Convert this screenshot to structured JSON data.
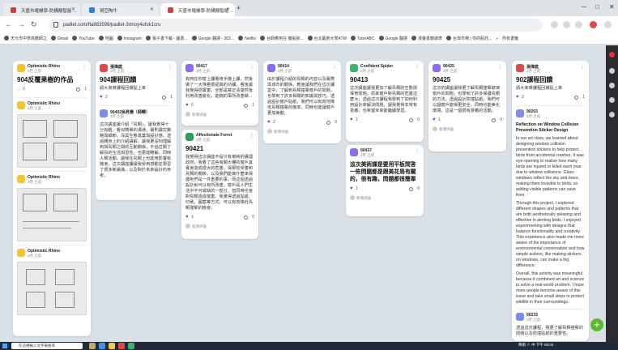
{
  "browser": {
    "tabs": [
      {
        "title": "天盛市電機學-防構擬智能 ...",
        "color": "#d83b3b"
      },
      {
        "title": "哥亞陶牛",
        "color": "#3b7bd8"
      },
      {
        "title": "天盛市電機學-防構擬智能 ...",
        "color": "#d83b3b"
      }
    ],
    "new_tab": "+",
    "window_controls": [
      "─",
      "□",
      "✕"
    ],
    "nav": {
      "back": "←",
      "forward": "→",
      "reload": "↻"
    },
    "url": "padlet.com/fla883599/padlet-3rtnoy4ufok1cru",
    "bookmarks": [
      "天元市中學高教師之",
      "Gmail",
      "YouTube",
      "地圖",
      "Instagram",
      "電子書下載 - 圖書...",
      "Google 翻譯 - 202...",
      "Netflix",
      "台師應用在 撤股資...",
      "台北藝術大學ATM",
      "TutorABC",
      "Google 翻譯",
      "漫畫書籍總表",
      "台灣市場 | 你的股託..."
    ],
    "bookmarks_more": "»",
    "all_bookmarks": "所有書籤"
  },
  "cards": {
    "c1": {
      "author": "Optimistic Rhino",
      "time": "3月 之前",
      "title": "904反覆果樹的作品",
      "likes": "0",
      "comments": "1",
      "sub": {
        "author": "Optimistic Rhino",
        "time": "3月 之前"
      },
      "sub2": {
        "author": "Optimistic Rhino",
        "time": "3月 之前"
      },
      "sub3": {
        "author": "Optimistic Rhino",
        "time": "3月 之前"
      }
    },
    "c2": {
      "author": "張偉庭",
      "time": "3月 之前",
      "title": "904課程回饋",
      "body": "請大家將課程回饋貼上來",
      "likes": "2",
      "comments": "1",
      "sub": {
        "author": "90402吳昇儒（師轉）",
        "time": "3月 之前",
        "body": "這次講座讓介紹「鳥類」。讓我覺得十分有趣，看似簡單的溝通，實則講究策略與細節，深具生態專業與設計感。透過親身上的介紹講解，讓我更深刻理解到與鳥類之間的互動關係，不過這類了解鳥的生活與習性。也更能瞭解，同時人類活動。讓我在鳥類上也能用影響有機會，這次講座課讓我受到感動並學習了很多新識識，以及對於未來設計的參考。"
      }
    },
    "c3": {
      "author": "90417",
      "time": "3月 之前",
      "body": "有時在你窗上課看用手機上課，然後做了一大堆看很認真的功課，看後讓我覺得很厲害，全部是寫正清楚然後利用改善變化，能夠的事所改善做...",
      "likes": "0",
      "comments": "1",
      "add_comment": "新增評論"
    },
    "c4": {
      "author": "Affectionate Ferret",
      "time": "3月 之前",
      "title": "90421",
      "body": "我覺得這次講座不是只有單純的講理 政府，我看了這些有關大樓的窗戶其實會造成很大的危害。得那些受害和鳥類的關係，以及我們能做什麼來保護牠們是一件重要的事，而這個透過設計就可以有所改善。窗戶是人們生活中不可或缺的一部分，但同時也會對鳥類造成傷害。我覺得透過貼紙、印刷、圖案等方式，可以有效降低鳥類撞擊的機會。",
      "likes": "1",
      "comments": "0",
      "add_comment": "新增評論"
    },
    "c5": {
      "author": "90414",
      "time": "3月 之前",
      "body": "由於課程介紹的鳥類的內容以及實際與城市的關係，教會讓我們在這次課堂中，了解到鳥類撞擊窗戶的問題，也學到了許多相關的知識與技巧。透過設計窗戶貼紙，我們可以有效地降低鳥類撞擊的機率，同時也能讓窗戶更加美觀。",
      "likes": "2",
      "comments": "0",
      "add_comment": "新增評論"
    },
    "c6": {
      "author": "Confident Spider",
      "time": "3月 之前",
      "title": "90413",
      "body": "這次講座讓我更加了解鳥類的生態與保育問題。原來窗戶對鳥類的危害這麼大，透過這次課程我學到了如何利用設計來解決問題，讓我覺得非常有意義，也希望未來能繼續學習。",
      "likes": "1",
      "comments": "0"
    },
    "c7": {
      "author": "90437",
      "time": "3月 之前",
      "body": "這次美術課是要用平板問答一些問題都是跟美花鳥有關的，很有趣，問題都很簡單",
      "likes": "1",
      "comments": "0",
      "add_comment": "新增評論"
    },
    "c8": {
      "author": "90425",
      "time": "3月 之前",
      "title": "90425",
      "body": "這次的講座讓我更了解鳥類撞擊玻璃窗戶的問題，也學到了許多保護鳥類的方法。透過設計防撞貼紙，我們可以讓窗戶變得更安全，同時也能美化環境，這是一個很有意義的活動。",
      "likes": "1",
      "comments": "0",
      "add_comment": "新增評論"
    },
    "c9": {
      "author": "張偉庭",
      "time": "3月 之前",
      "title": "902課程回饋",
      "body": "請大家將課程回饋貼上來",
      "likes": "2",
      "comments": "1",
      "sub": {
        "author": "90203",
        "time": "3月 之前",
        "title": "Reflection on Window Collision Prevention Sticker Design",
        "body": "In our art class, we learned about designing window collision prevention stickers to help protect birds from accidental crashes. It was eye-opening to realize how many birds are injured or killed each year due to window collisions. Glass windows reflect the sky and trees, making them invisible to birds, so adding visible patterns can save lives.",
        "body2": "Through this project, I explored different shapes and patterns that are both aesthetically pleasing and effective in alerting birds. I enjoyed experimenting with designs that balance functionality and creativity. This experience also made me more aware of the importance of environmental conservation and how simple actions, like making stickers on windows, can make a big difference.",
        "body3": "Overall, this activity was meaningful because it combined art and science to solve a real-world problem. I hope more people become aware of this issue and take small steps to protect wildlife in their surroundings."
      },
      "sub2": {
        "author": "90233",
        "time": "3月 之前",
        "body": "透過這次課程，我更了解鳥類撞擊的問題以及防撞貼紙的重要性。"
      }
    }
  },
  "fab": "+",
  "taskbar": {
    "search": "在這裡輸入文字來搜尋",
    "tray": "降雨  ∧ 中  下午 08:02"
  },
  "colors": {
    "canvas": "#d9e0e6",
    "heart": "#6b3fd6",
    "fab": "#5cb82f",
    "sidebar": "#2c2c30"
  }
}
